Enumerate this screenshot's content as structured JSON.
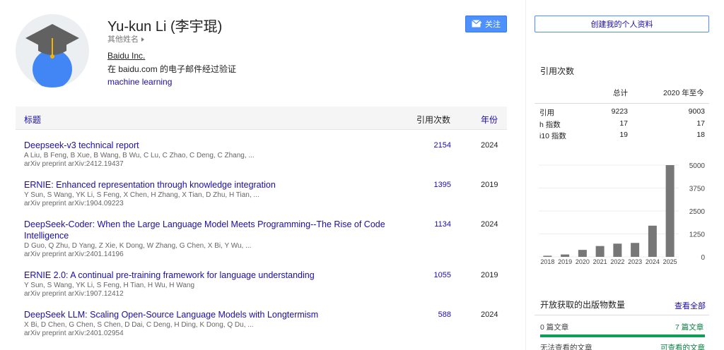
{
  "profile": {
    "name": "Yu-kun Li (李宇琨)",
    "other_names": "其他姓名",
    "affiliation": "Baidu Inc",
    "affiliation_suffix": ".",
    "verified_email": "在 baidu.com 的电子邮件经过验证",
    "interest": "machine learning"
  },
  "follow_button": "关注",
  "table": {
    "headers": {
      "title": "标题",
      "cited": "引用次数",
      "year": "年份"
    },
    "rows": [
      {
        "title": "Deepseek-v3 technical report",
        "authors": "A Liu, B Feng, B Xue, B Wang, B Wu, C Lu, C Zhao, C Deng, C Zhang, ...",
        "venue": "arXiv preprint arXiv:2412.19437",
        "cited": "2154",
        "year": "2024"
      },
      {
        "title": "ERNIE: Enhanced representation through knowledge integration",
        "authors": "Y Sun, S Wang, YK Li, S Feng, X Chen, H Zhang, X Tian, D Zhu, H Tian, ...",
        "venue": "arXiv preprint arXiv:1904.09223",
        "cited": "1395",
        "year": "2019"
      },
      {
        "title": "DeepSeek-Coder: When the Large Language Model Meets Programming--The Rise of Code Intelligence",
        "authors": "D Guo, Q Zhu, D Yang, Z Xie, K Dong, W Zhang, G Chen, X Bi, Y Wu, ...",
        "venue": "arXiv preprint arXiv:2401.14196",
        "cited": "1134",
        "year": "2024"
      },
      {
        "title": "ERNIE 2.0: A continual pre-training framework for language understanding",
        "authors": "Y Sun, S Wang, YK Li, S Feng, H Tian, H Wu, H Wang",
        "venue": "arXiv preprint arXiv:1907.12412",
        "cited": "1055",
        "year": "2019"
      },
      {
        "title": "DeepSeek LLM: Scaling Open-Source Language Models with Longtermism",
        "authors": "X Bi, D Chen, G Chen, S Chen, D Dai, C Deng, H Ding, K Dong, Q Du, ...",
        "venue": "arXiv preprint arXiv:2401.02954",
        "cited": "588",
        "year": "2024"
      }
    ]
  },
  "sidebar": {
    "create_profile": "创建我的个人资料",
    "cited_by": "引用次数",
    "col_total": "总计",
    "col_since": "2020 年至今",
    "metrics": [
      {
        "label": "引用",
        "total": "9223",
        "since": "9003"
      },
      {
        "label": "h 指数",
        "total": "17",
        "since": "17"
      },
      {
        "label": "i10 指数",
        "total": "19",
        "since": "18"
      }
    ],
    "open_access": {
      "heading": "开放获取的出版物数量",
      "view_all": "查看全部",
      "unavailable": "0 篇文章",
      "available": "7 篇文章",
      "unavailable_label": "无法查看的文章",
      "available_label": "可查看的文章"
    }
  },
  "chart_data": {
    "type": "bar",
    "categories": [
      "2018",
      "2019",
      "2020",
      "2021",
      "2022",
      "2023",
      "2024",
      "2025"
    ],
    "values": [
      60,
      130,
      380,
      590,
      720,
      760,
      1700,
      5000
    ],
    "yticks": [
      "0",
      "1250",
      "2500",
      "3750",
      "5000"
    ],
    "ylim": [
      0,
      5000
    ],
    "bar_color": "#777777",
    "grid": true
  },
  "colors": {
    "link": "#1a0dab",
    "primary_button": "#4d90fe",
    "open_access_green": "#0f9d58"
  }
}
